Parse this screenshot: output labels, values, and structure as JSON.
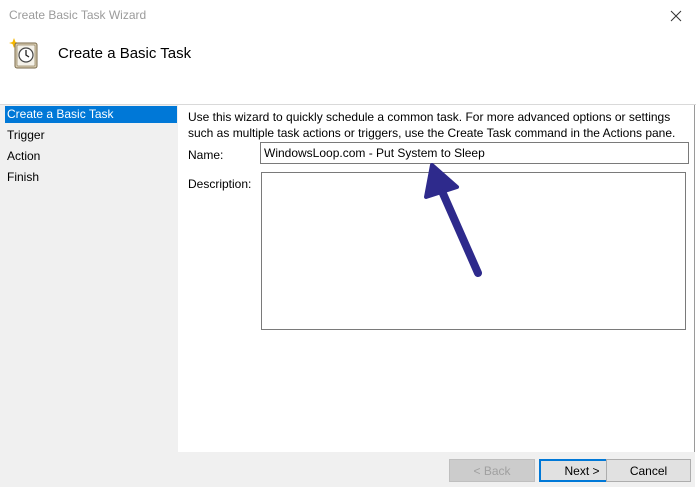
{
  "window": {
    "title": "Create Basic Task Wizard"
  },
  "header": {
    "title": "Create a Basic Task",
    "icon": "task-scheduler-clock-icon"
  },
  "sidebar": {
    "items": [
      {
        "label": "Create a Basic Task",
        "active": true
      },
      {
        "label": "Trigger",
        "active": false
      },
      {
        "label": "Action",
        "active": false
      },
      {
        "label": "Finish",
        "active": false
      }
    ]
  },
  "main": {
    "intro": "Use this wizard to quickly schedule a common task.  For more advanced options or settings such as multiple task actions or triggers, use the Create Task command in the Actions pane.",
    "name_label": "Name:",
    "name_value": "WindowsLoop.com - Put System to Sleep",
    "description_label": "Description:",
    "description_value": ""
  },
  "buttons": {
    "back": "< Back",
    "next": "Next >",
    "cancel": "Cancel"
  },
  "annotation": {
    "arrow_color": "#2e2a8c"
  },
  "colors": {
    "selection": "#0078d7",
    "sidebar_bg": "#f0f0f0"
  }
}
